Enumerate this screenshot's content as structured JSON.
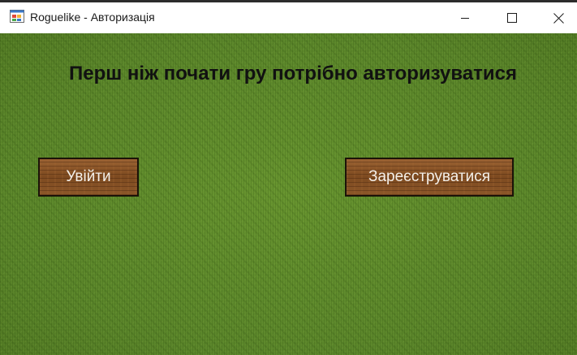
{
  "window": {
    "title": "Roguelike - Авторизація",
    "icon": "app-window-icon",
    "controls": {
      "minimize_icon": "minimize-icon",
      "maximize_icon": "maximize-icon",
      "close_icon": "close-icon"
    }
  },
  "main": {
    "heading": "Перш ніж почати гру потрібно авторизуватися",
    "login_label": "Увійти",
    "register_label": "Зареєструватися"
  },
  "colors": {
    "background": "#5d8a2c",
    "button_wood": "#8a5628",
    "button_text": "#f4f0ea",
    "heading_text": "#111111"
  }
}
